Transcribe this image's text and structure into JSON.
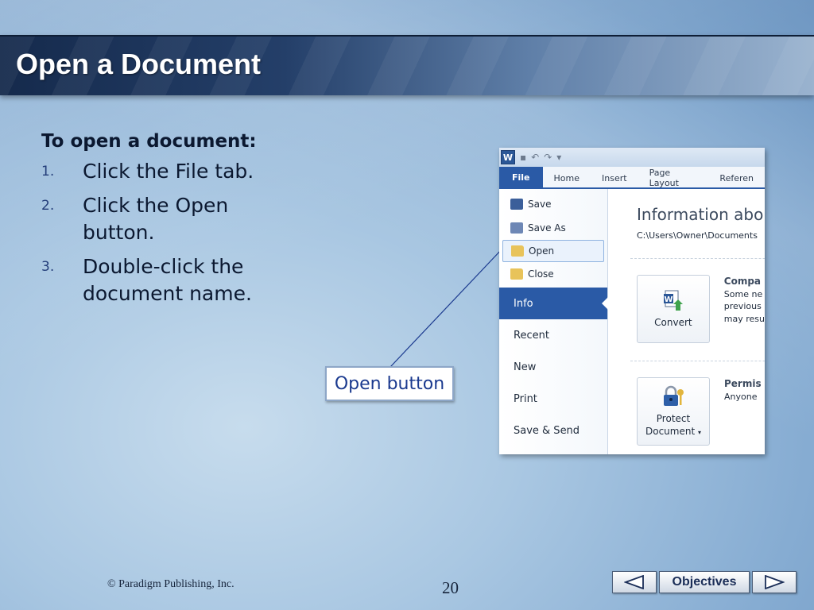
{
  "title": "Open a Document",
  "instructions": {
    "heading": "To open a document:",
    "steps": [
      {
        "num": "1.",
        "text": "Click the File tab."
      },
      {
        "num": "2.",
        "text": "Click the Open button."
      },
      {
        "num": "3.",
        "text": "Double-click the document name."
      }
    ]
  },
  "callout": {
    "label": "Open button"
  },
  "word": {
    "tabs": [
      "File",
      "Home",
      "Insert",
      "Page Layout",
      "Referen"
    ],
    "commands": [
      "Save",
      "Save As",
      "Open",
      "Close"
    ],
    "sections": [
      "Info",
      "Recent",
      "New",
      "Print",
      "Save & Send"
    ],
    "info_title": "Information abo",
    "info_path": "C:\\Users\\Owner\\Documents",
    "convert": {
      "button": "Convert",
      "heading": "Compa",
      "lines": [
        "Some ne",
        "previous",
        "may resu"
      ]
    },
    "protect": {
      "button_line1": "Protect",
      "button_line2": "Document",
      "heading": "Permis",
      "lines": [
        "Anyone"
      ]
    }
  },
  "footer": {
    "copyright": "© Paradigm Publishing, Inc.",
    "page_number": "20",
    "objectives_label": "Objectives"
  },
  "colors": {
    "accent": "#2a5aa6",
    "title_bar": "#1f3a63"
  }
}
